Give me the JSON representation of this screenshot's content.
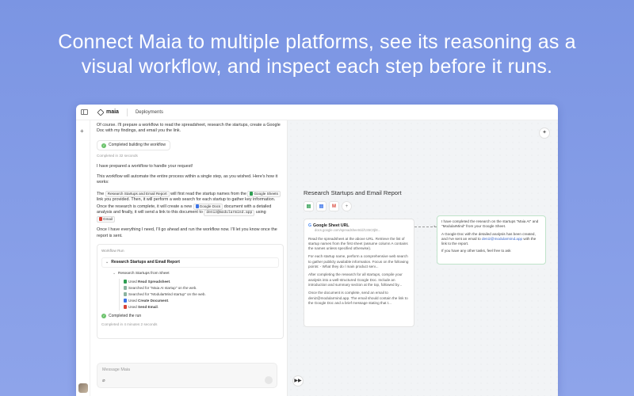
{
  "headline": {
    "line1": "Connect Maia to multiple platforms, see its reasoning as a",
    "line2": "visual workflow, and inspect each step before it runs."
  },
  "topbar": {
    "app_name": "maia",
    "tab": "Deployments"
  },
  "chat": {
    "intro": "Of course. I'll prepare a workflow to read the spreadsheet, research the startups, create a Google Doc with my findings, and email you the link.",
    "status_label": "Completed building the workflow",
    "status_time": "Completed in 32 seconds",
    "p1": "I have prepared a workflow to handle your request!",
    "p2": "This workflow will automate the entire process within a single step, as you wished. Here's how it works:",
    "p3_a": "The",
    "chip_workflow": "Research Startups and Email Report",
    "p3_b": "will first read the startup names from the",
    "chip_sheets": "Google Sheets",
    "p3_c": "link you provided. Then, it will perform a web search for each startup to gather key information. Once the research is complete, it will create a new",
    "chip_docs": "Google Docs",
    "p3_d": "document with a detailed analysis and finally, it will send a link to this document to",
    "email": "deniz@modularmind.app",
    "p3_e": "using",
    "chip_gmail": "Gmail",
    "p4": "Once I have everything I need, I'll go ahead and run the workflow now. I'll let you know once the report is sent.",
    "run": {
      "header": "Workflow Run",
      "title": "Research Startups and Email Report",
      "sub": "Research Startups from Sheet",
      "steps": [
        {
          "pre": "Used",
          "bold": "Read Spreadsheet",
          "post": ".",
          "color": "#2e9e52"
        },
        {
          "pre": "Searched for \"Maia AI startup\" on the web.",
          "bold": "",
          "post": "",
          "color": "#8bb3a0"
        },
        {
          "pre": "Searched for \"ModularMind startup\" on the web.",
          "bold": "",
          "post": "",
          "color": "#8bb3a0"
        },
        {
          "pre": "Used",
          "bold": "Create Document",
          "post": ".",
          "color": "#3a73e8"
        },
        {
          "pre": "Used",
          "bold": "Send Email",
          "post": ".",
          "color": "#d84437"
        }
      ],
      "complete_label": "Completed the run",
      "complete_time": "Completed in 4 minutes 2 seconds"
    },
    "input_placeholder": "Message Maia"
  },
  "canvas": {
    "workflow_title": "Research Startups and Email Report",
    "node1": {
      "title": "Google Sheet URL",
      "url": "docs.google.com/spreadsheets/d/1S5C0jl8...",
      "p1": "Read the spreadsheet at the above URL. Retrieve the list of startup names from the first sheet (assume column A contains the names unless specified otherwise).",
      "p2": "For each startup name, perform a comprehensive web search to gather publicly available information. Focus on the following points: - What they do / main product serv...",
      "p3": "After completing the research for all startups, compile your analysis into a well-structured Google Doc. Include an introduction and summary section at the top, followed by...",
      "p4": "Once the document is complete, send an email to deniz@modularmind.app. The email should contain the link to the Google Doc and a brief message stating that t..."
    },
    "node2": {
      "p1": "I have completed the research on the startups \"Maia AI\" and \"ModularMind\" from your Google Sheet.",
      "p2_a": "A Google Doc with the detailed analysis has been created, and I've sent an email to",
      "p2_link": "deniz@modularmind.app",
      "p2_b": "with the link to the report.",
      "p3": "If you have any other tasks, feel free to ask"
    }
  }
}
